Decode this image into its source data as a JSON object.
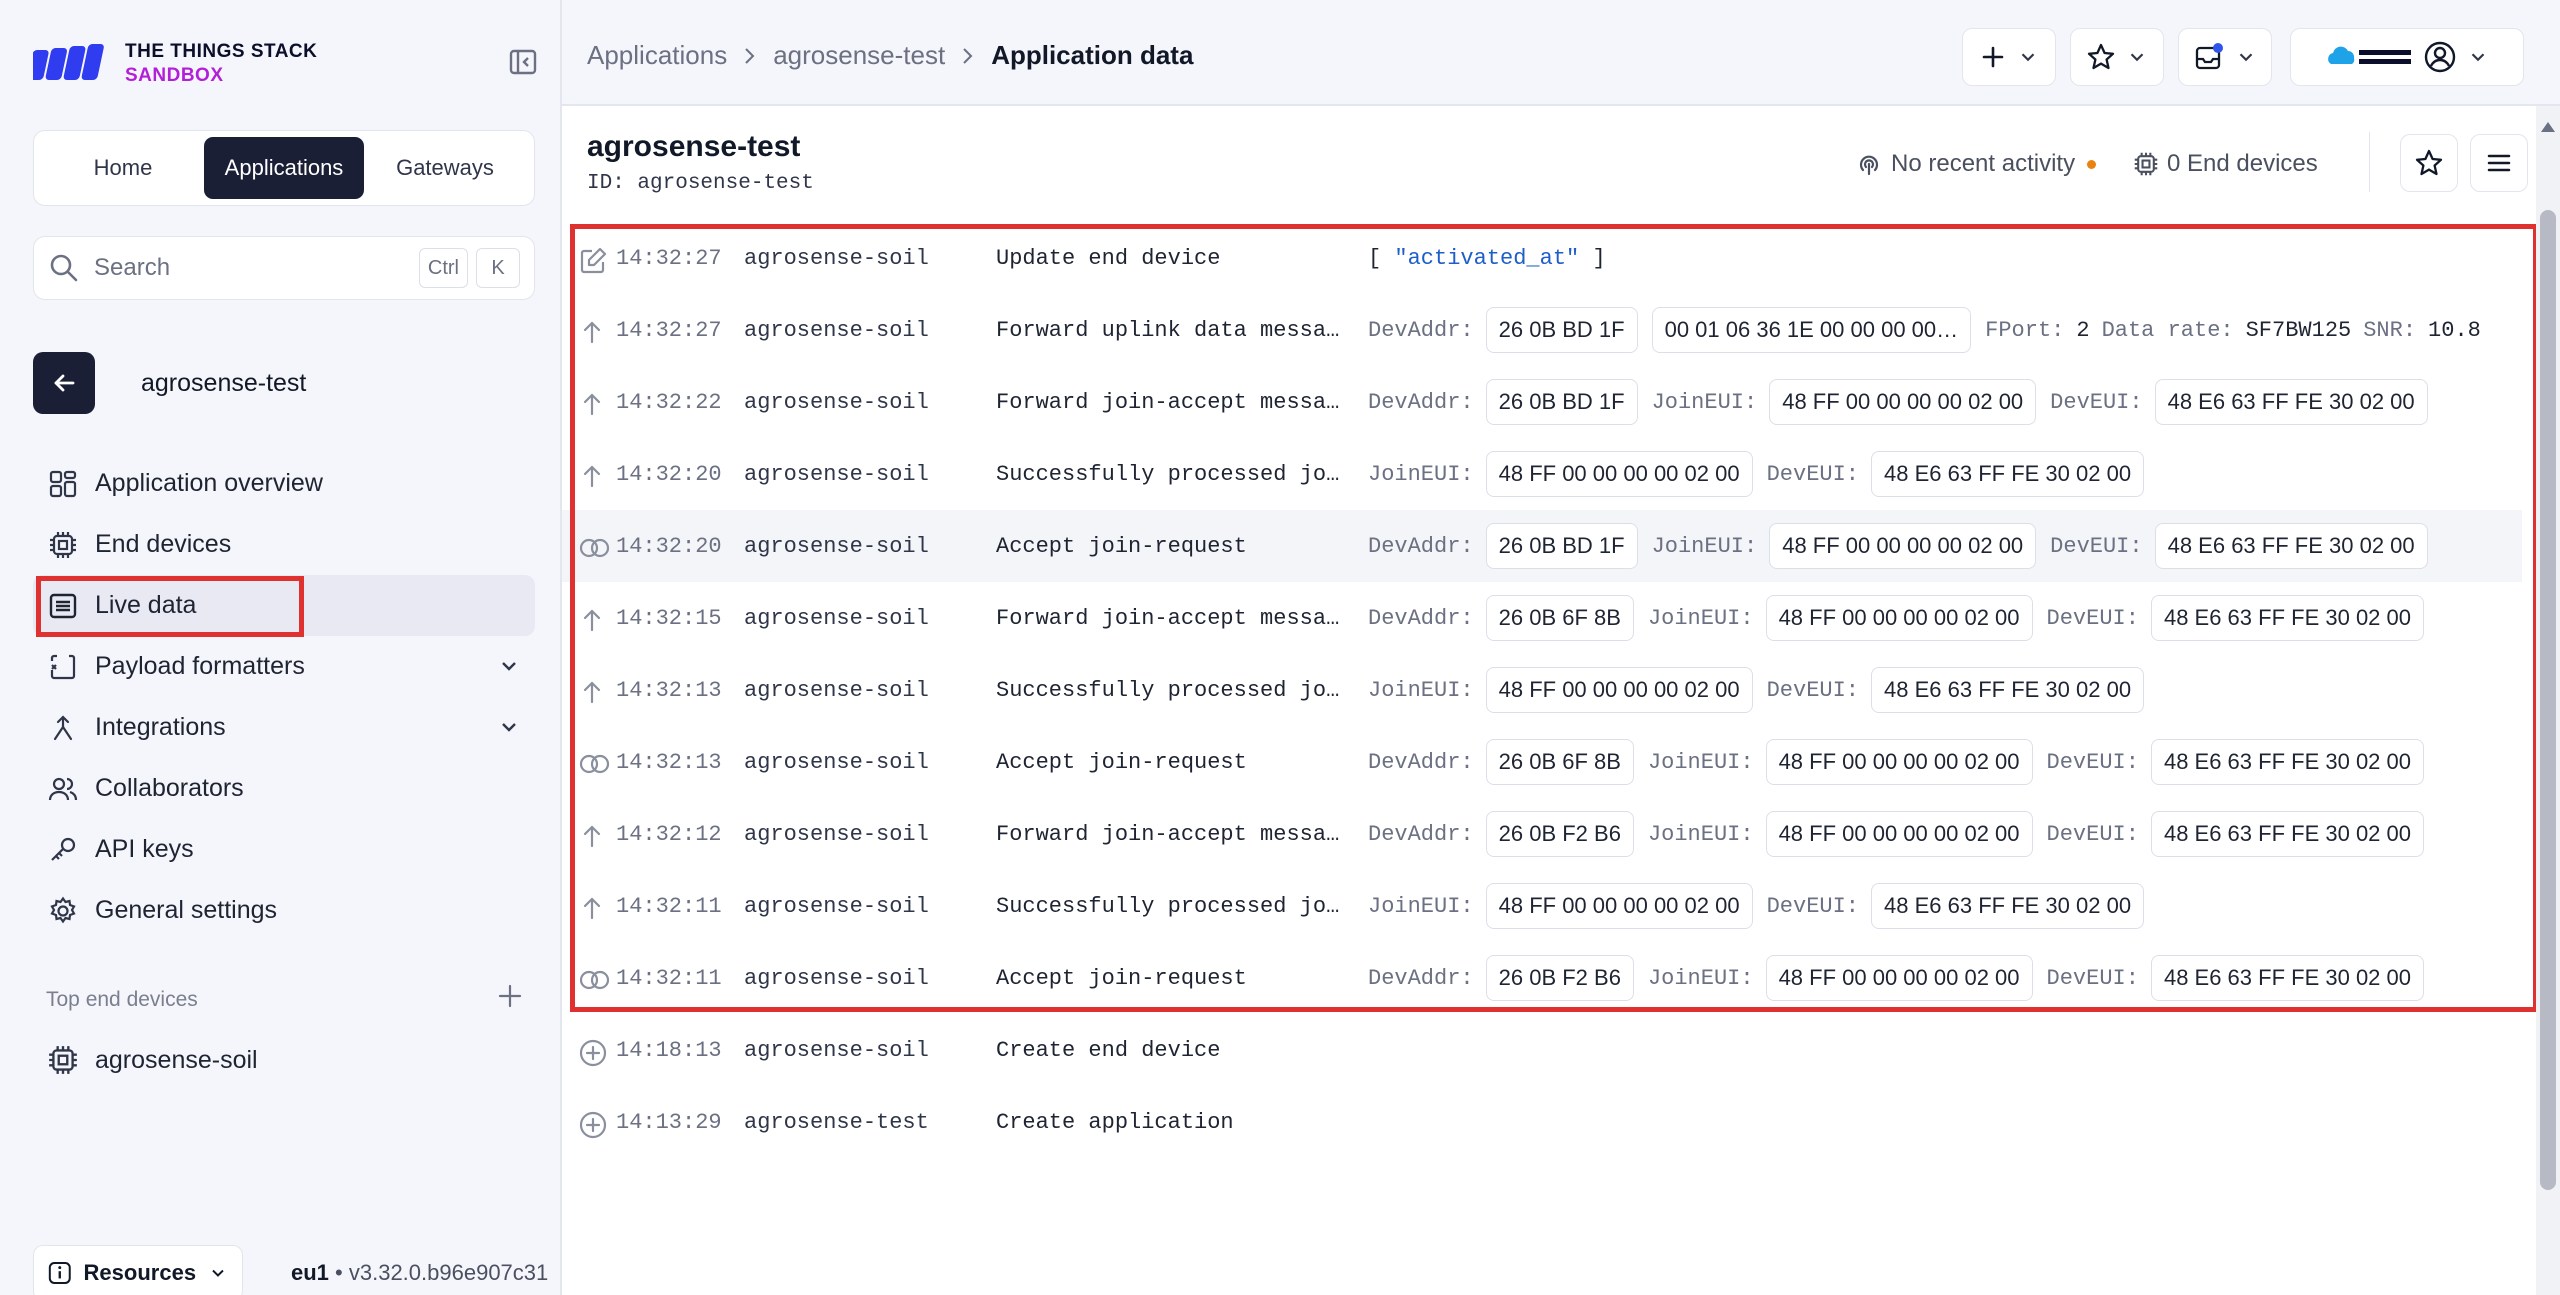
{
  "brand": {
    "line1": "THE THINGS STACK",
    "line2": "SANDBOX"
  },
  "mainnav": [
    {
      "label": "Home",
      "active": false
    },
    {
      "label": "Applications",
      "active": true
    },
    {
      "label": "Gateways",
      "active": false
    }
  ],
  "search": {
    "placeholder": "Search",
    "kbd1": "Ctrl",
    "kbd2": "K"
  },
  "sidebar": {
    "back_label": "agrosense-test",
    "items": [
      {
        "label": "Application overview",
        "icon": "grid-icon"
      },
      {
        "label": "End devices",
        "icon": "chip-icon"
      },
      {
        "label": "Live data",
        "icon": "list-icon",
        "active": true
      },
      {
        "label": "Payload formatters",
        "icon": "code-icon",
        "expandable": true
      },
      {
        "label": "Integrations",
        "icon": "integrations-icon",
        "expandable": true
      },
      {
        "label": "Collaborators",
        "icon": "users-icon"
      },
      {
        "label": "API keys",
        "icon": "key-icon"
      },
      {
        "label": "General settings",
        "icon": "gear-icon"
      }
    ],
    "top_devices_title": "Top end devices",
    "top_devices": [
      {
        "label": "agrosense-soil"
      }
    ],
    "resources_label": "Resources",
    "cluster": "eu1",
    "version": "v3.32.0.b96e907c31"
  },
  "breadcrumb": {
    "items": [
      "Applications",
      "agrosense-test"
    ],
    "current": "Application data"
  },
  "app": {
    "title": "agrosense-test",
    "id_label": "ID:",
    "id_value": "agrosense-test",
    "activity": "No recent activity",
    "end_devices": "0 End devices"
  },
  "events": [
    {
      "icon": "edit-icon",
      "time": "14:32:27",
      "device": "agrosense-soil",
      "name": "Update end device",
      "json": [
        "[",
        "\"activated_at\"",
        "]"
      ]
    },
    {
      "icon": "uplink-icon",
      "time": "14:32:27",
      "device": "agrosense-soil",
      "name": "Forward uplink data message",
      "fields": [
        {
          "label": "DevAddr:",
          "chip": "26 0B BD 1F"
        },
        {
          "chip": "00 01 06 36 1E 00 00 00 00…"
        },
        {
          "label": "FPort:",
          "text": "2"
        },
        {
          "label": "Data rate:",
          "text": "SF7BW125"
        },
        {
          "label": "SNR:",
          "text": "10.8"
        }
      ]
    },
    {
      "icon": "uplink-icon",
      "time": "14:32:22",
      "device": "agrosense-soil",
      "name": "Forward join-accept message",
      "fields": [
        {
          "label": "DevAddr:",
          "chip": "26 0B BD 1F"
        },
        {
          "label": "JoinEUI:",
          "chip": "48 FF 00 00 00 00 02 00"
        },
        {
          "label": "DevEUI:",
          "chip": "48 E6 63 FF FE 30 02 00"
        }
      ]
    },
    {
      "icon": "uplink-icon",
      "time": "14:32:20",
      "device": "agrosense-soil",
      "name": "Successfully processed joi…",
      "fields": [
        {
          "label": "JoinEUI:",
          "chip": "48 FF 00 00 00 00 02 00"
        },
        {
          "label": "DevEUI:",
          "chip": "48 E6 63 FF FE 30 02 00"
        }
      ]
    },
    {
      "icon": "join-icon",
      "time": "14:32:20",
      "device": "agrosense-soil",
      "name": "Accept join-request",
      "hl": true,
      "fields": [
        {
          "label": "DevAddr:",
          "chip": "26 0B BD 1F"
        },
        {
          "label": "JoinEUI:",
          "chip": "48 FF 00 00 00 00 02 00"
        },
        {
          "label": "DevEUI:",
          "chip": "48 E6 63 FF FE 30 02 00"
        }
      ]
    },
    {
      "icon": "uplink-icon",
      "time": "14:32:15",
      "device": "agrosense-soil",
      "name": "Forward join-accept message",
      "fields": [
        {
          "label": "DevAddr:",
          "chip": "26 0B 6F 8B"
        },
        {
          "label": "JoinEUI:",
          "chip": "48 FF 00 00 00 00 02 00"
        },
        {
          "label": "DevEUI:",
          "chip": "48 E6 63 FF FE 30 02 00"
        }
      ]
    },
    {
      "icon": "uplink-icon",
      "time": "14:32:13",
      "device": "agrosense-soil",
      "name": "Successfully processed joi…",
      "fields": [
        {
          "label": "JoinEUI:",
          "chip": "48 FF 00 00 00 00 02 00"
        },
        {
          "label": "DevEUI:",
          "chip": "48 E6 63 FF FE 30 02 00"
        }
      ]
    },
    {
      "icon": "join-icon",
      "time": "14:32:13",
      "device": "agrosense-soil",
      "name": "Accept join-request",
      "fields": [
        {
          "label": "DevAddr:",
          "chip": "26 0B 6F 8B"
        },
        {
          "label": "JoinEUI:",
          "chip": "48 FF 00 00 00 00 02 00"
        },
        {
          "label": "DevEUI:",
          "chip": "48 E6 63 FF FE 30 02 00"
        }
      ]
    },
    {
      "icon": "uplink-icon",
      "time": "14:32:12",
      "device": "agrosense-soil",
      "name": "Forward join-accept message",
      "fields": [
        {
          "label": "DevAddr:",
          "chip": "26 0B F2 B6"
        },
        {
          "label": "JoinEUI:",
          "chip": "48 FF 00 00 00 00 02 00"
        },
        {
          "label": "DevEUI:",
          "chip": "48 E6 63 FF FE 30 02 00"
        }
      ]
    },
    {
      "icon": "uplink-icon",
      "time": "14:32:11",
      "device": "agrosense-soil",
      "name": "Successfully processed joi…",
      "fields": [
        {
          "label": "JoinEUI:",
          "chip": "48 FF 00 00 00 00 02 00"
        },
        {
          "label": "DevEUI:",
          "chip": "48 E6 63 FF FE 30 02 00"
        }
      ]
    },
    {
      "icon": "join-icon",
      "time": "14:32:11",
      "device": "agrosense-soil",
      "name": "Accept join-request",
      "fields": [
        {
          "label": "DevAddr:",
          "chip": "26 0B F2 B6"
        },
        {
          "label": "JoinEUI:",
          "chip": "48 FF 00 00 00 00 02 00"
        },
        {
          "label": "DevEUI:",
          "chip": "48 E6 63 FF FE 30 02 00"
        }
      ]
    },
    {
      "icon": "create-icon",
      "time": "14:18:13",
      "device": "agrosense-soil",
      "name": "Create end device"
    },
    {
      "icon": "create-icon",
      "time": "14:13:29",
      "device": "agrosense-test",
      "name": "Create application"
    }
  ],
  "colors": {
    "accent": "#1a1f36",
    "highlight": "#e03131",
    "brand_purple": "#b31fd8",
    "activity_dot": "#e9820f",
    "json_string": "#1d5ec9"
  }
}
